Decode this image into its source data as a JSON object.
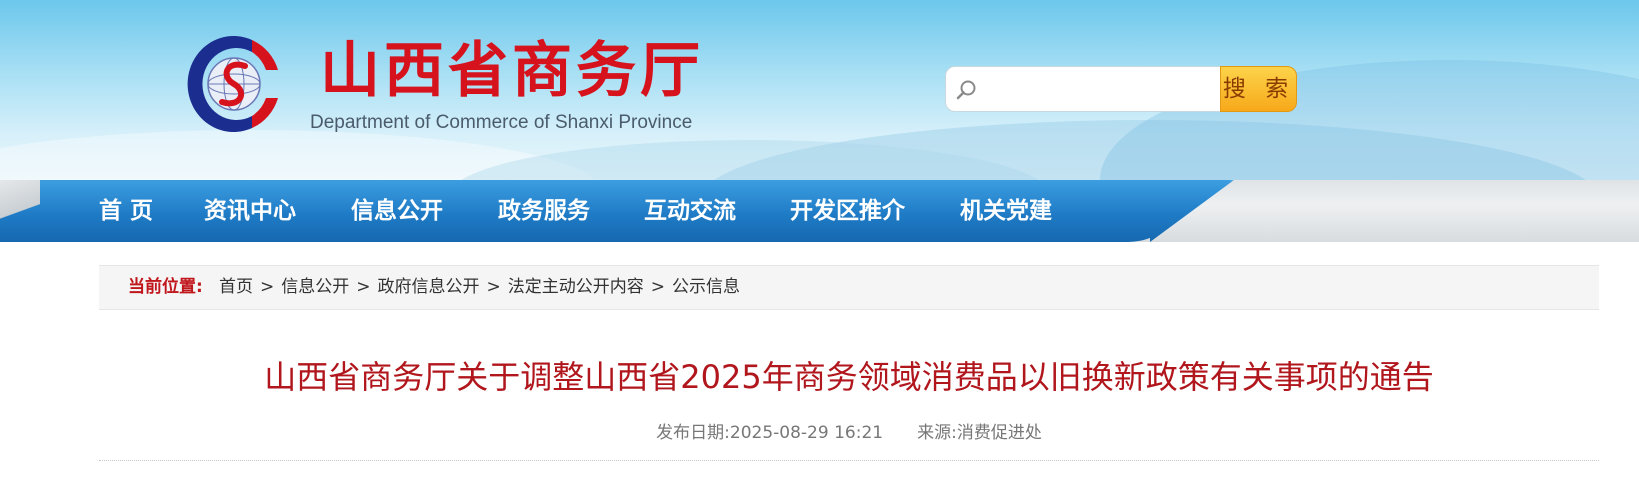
{
  "header": {
    "title": "山西省商务厅",
    "subtitle": "Department of Commerce of Shanxi Province",
    "search": {
      "placeholder": "",
      "button_label": "搜 索"
    }
  },
  "nav": {
    "items": [
      {
        "label": "首  页"
      },
      {
        "label": "资讯中心"
      },
      {
        "label": "信息公开"
      },
      {
        "label": "政务服务"
      },
      {
        "label": "互动交流"
      },
      {
        "label": "开发区推介"
      },
      {
        "label": "机关党建"
      }
    ]
  },
  "breadcrumb": {
    "label": "当前位置:",
    "items": [
      "首页",
      "信息公开",
      "政府信息公开",
      "法定主动公开内容",
      "公示信息"
    ],
    "separator": ">"
  },
  "article": {
    "title": "山西省商务厅关于调整山西省2025年商务领域消费品以旧换新政策有关事项的通告",
    "date_label": "发布日期:",
    "date": "2025-08-29 16:21",
    "source_label": "来源:",
    "source": "消费促进处"
  },
  "colors": {
    "brand_red": "#d6121d",
    "nav_blue": "#1f7bc6",
    "search_orange": "#f7a91a"
  }
}
